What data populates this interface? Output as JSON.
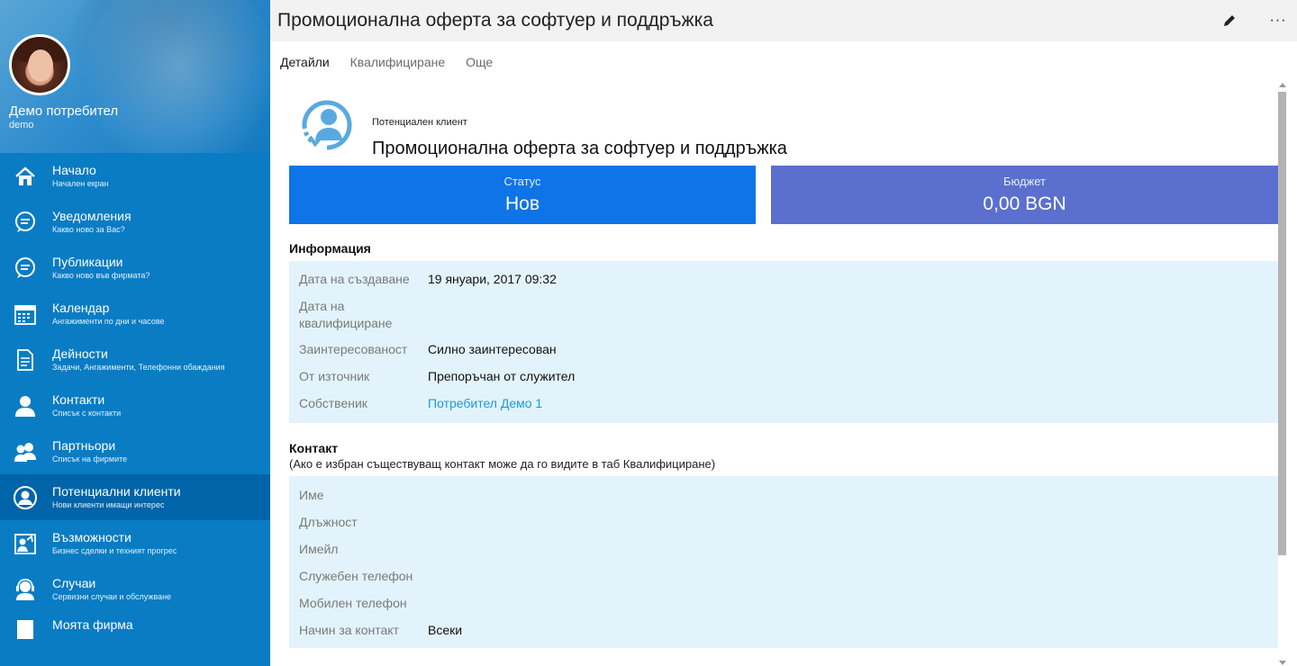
{
  "user": {
    "name": "Демо потребител",
    "login": "demo"
  },
  "nav": [
    {
      "label": "Начало",
      "sub": "Начален екран",
      "icon": "home-icon"
    },
    {
      "label": "Уведомления",
      "sub": "Какво ново за Вас?",
      "icon": "chat-bubble-icon"
    },
    {
      "label": "Публикации",
      "sub": "Какво ново във фирмата?",
      "icon": "chat-bubble-icon"
    },
    {
      "label": "Календар",
      "sub": "Ангажименти по дни и часове",
      "icon": "calendar-icon"
    },
    {
      "label": "Дейности",
      "sub": "Задачи, Ангажименти, Телефонни обаждания",
      "icon": "document-icon"
    },
    {
      "label": "Контакти",
      "sub": "Списък с контакти",
      "icon": "person-icon"
    },
    {
      "label": "Партньори",
      "sub": "Списък на фирмите",
      "icon": "people-icon"
    },
    {
      "label": "Потенциални клиенти",
      "sub": "Нови клиенти имащи интерес",
      "icon": "lead-icon"
    },
    {
      "label": "Възможности",
      "sub": "Бизнес сделки и техният прогрес",
      "icon": "opportunity-icon"
    },
    {
      "label": "Случаи",
      "sub": "Сервизни случаи и обслужване",
      "icon": "headset-icon"
    },
    {
      "label": "Моята фирма",
      "sub": "",
      "icon": "building-icon"
    }
  ],
  "active_nav_index": 7,
  "header": {
    "title": "Промоционална оферта за софтуер и поддръжка",
    "edit_icon": "pencil-icon",
    "more_label": "···"
  },
  "tabs": [
    {
      "label": "Детайли",
      "active": true
    },
    {
      "label": "Квалифициране",
      "active": false
    },
    {
      "label": "Още",
      "active": false
    }
  ],
  "lead": {
    "type": "Потенциален клиент",
    "name": "Промоционална оферта за софтуер и поддръжка"
  },
  "tiles": {
    "status": {
      "title": "Статус",
      "value": "Нов",
      "color": "#0e74e8"
    },
    "budget": {
      "title": "Бюджет",
      "value": "0,00 BGN",
      "color": "#5b6fcf"
    }
  },
  "info": {
    "title": "Информация",
    "rows": [
      {
        "label": "Дата на създаване",
        "value": "19 януари, 2017 09:32"
      },
      {
        "label": "Дата на квалифициране",
        "value": ""
      },
      {
        "label": "Заинтересованост",
        "value": "Силно заинтересован"
      },
      {
        "label": "От източник",
        "value": "Препоръчан от служител"
      },
      {
        "label": "Собственик",
        "value": "Потребител Демо 1",
        "link": true
      }
    ]
  },
  "contact": {
    "title": "Контакт",
    "note": "(Ако е избран съществуващ контакт може да го видите в таб Квалифициране)",
    "rows": [
      {
        "label": "Име",
        "value": ""
      },
      {
        "label": "Длъжност",
        "value": ""
      },
      {
        "label": "Имейл",
        "value": ""
      },
      {
        "label": "Служебен телефон",
        "value": ""
      },
      {
        "label": "Мобилен телефон",
        "value": ""
      },
      {
        "label": "Начин за контакт",
        "value": "Всеки"
      }
    ]
  },
  "colors": {
    "sidebar": "#0a7cc4",
    "sidebar_active": "#0064a8",
    "panel": "#e2f3fc",
    "link": "#1a9bd7"
  }
}
